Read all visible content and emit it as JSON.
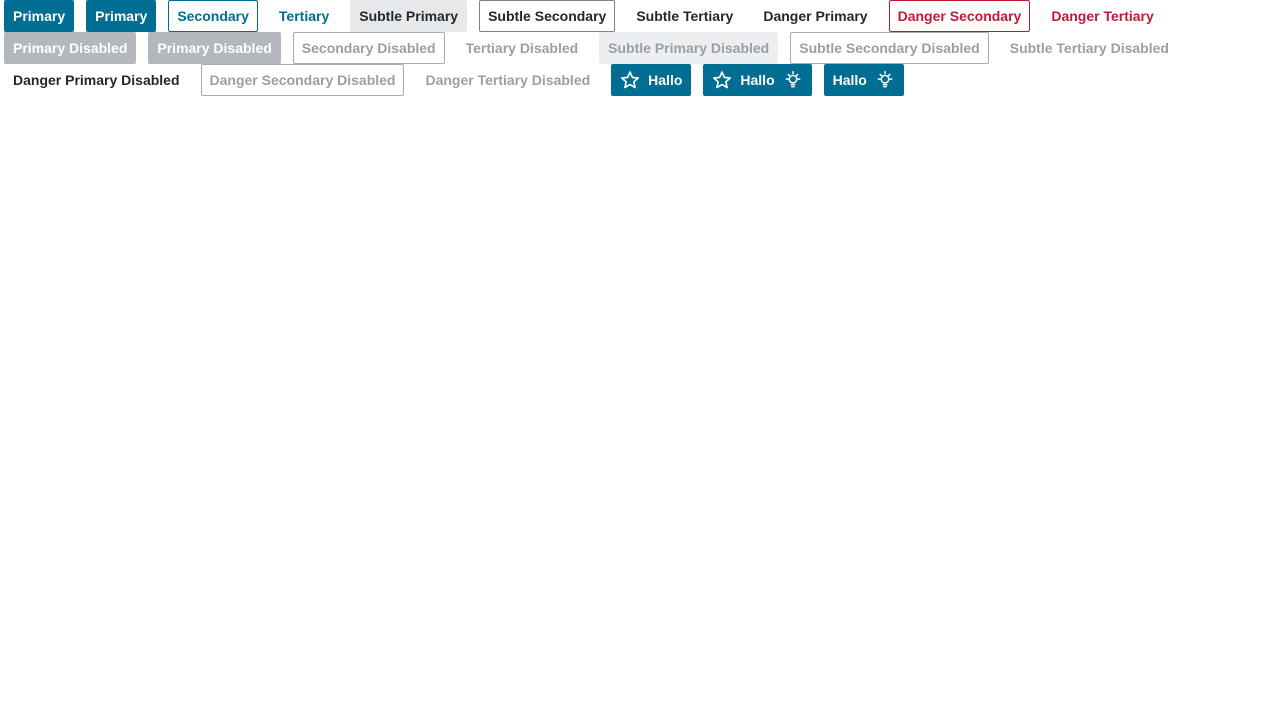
{
  "rows": {
    "row1": {
      "primary_1": "Primary",
      "primary_2": "Primary",
      "secondary": "Secondary",
      "tertiary": "Tertiary",
      "subtle_primary": "Subtle Primary",
      "subtle_secondary": "Subtle Secondary",
      "subtle_tertiary": "Subtle Tertiary",
      "danger_primary": "Danger Primary",
      "danger_secondary": "Danger Secondary",
      "danger_tertiary": "Danger Tertiary"
    },
    "row2": {
      "primary_disabled_1": "Primary Disabled",
      "primary_disabled_2": "Primary Disabled",
      "secondary_disabled": "Secondary Disabled",
      "tertiary_disabled": "Tertiary Disabled",
      "subtle_primary_disabled": "Subtle Primary Disabled",
      "subtle_secondary_disabled": "Subtle Secondary Disabled",
      "subtle_tertiary_disabled": "Subtle Tertiary Disabled"
    },
    "row3": {
      "danger_primary_disabled": "Danger Primary Disabled",
      "danger_secondary_disabled": "Danger Secondary Disabled",
      "danger_tertiary_disabled": "Danger Tertiary Disabled",
      "icon_button_1": "Hallo",
      "icon_button_2": "Hallo",
      "icon_button_3": "Hallo"
    }
  },
  "icons": {
    "leading": "star-icon",
    "trailing": "lightbulb-icon"
  },
  "colors": {
    "brand_primary": "#006e93",
    "danger": "#c4183a",
    "text_dark": "#23282d",
    "disabled_fill": "#b4b8bc",
    "disabled_text": "#9a9fa4",
    "subtle_fill": "#e6e8ea"
  }
}
